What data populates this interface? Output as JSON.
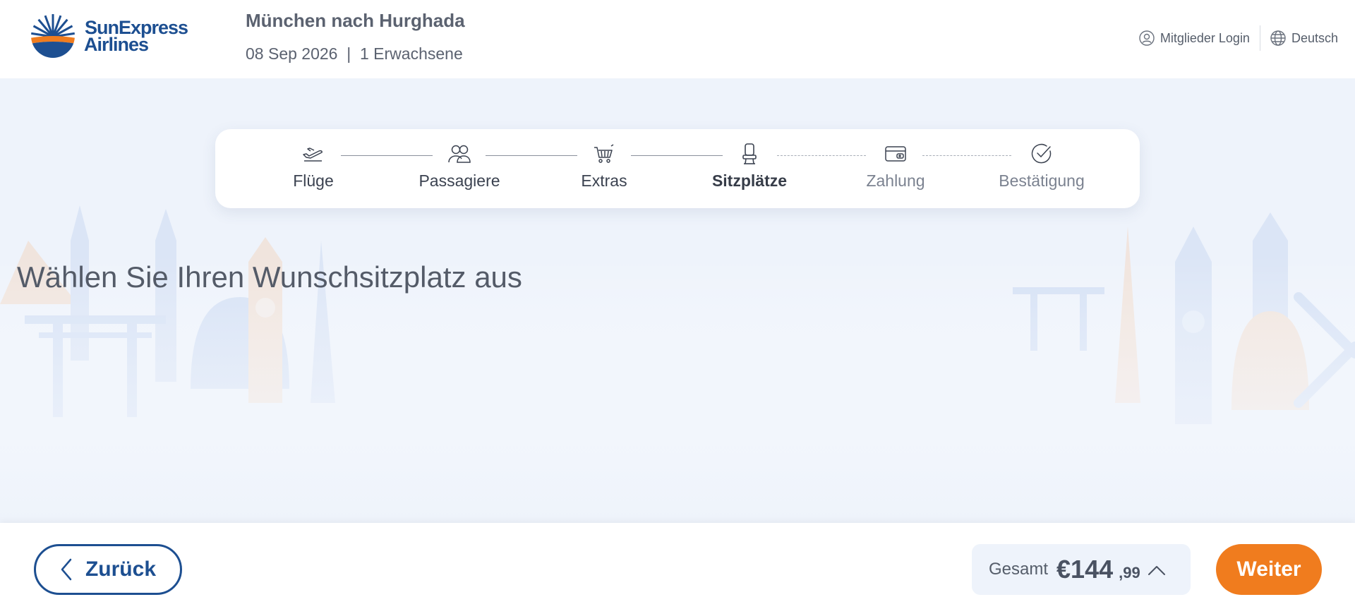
{
  "brand": {
    "line1": "SunExpress",
    "line2": "Airlines"
  },
  "trip": {
    "title": "München nach Hurghada",
    "subtitle": "08 Sep 2026  |  1 Erwachsene"
  },
  "header": {
    "login_label": "Mitglieder Login",
    "language_label": "Deutsch"
  },
  "steps": [
    {
      "label": "Flüge",
      "icon": "plane-departure-icon",
      "state": "done"
    },
    {
      "label": "Passagiere",
      "icon": "passengers-icon",
      "state": "done"
    },
    {
      "label": "Extras",
      "icon": "cart-icon",
      "state": "done"
    },
    {
      "label": "Sitzplätze",
      "icon": "seat-icon",
      "state": "active"
    },
    {
      "label": "Zahlung",
      "icon": "wallet-icon",
      "state": "future"
    },
    {
      "label": "Bestätigung",
      "icon": "checkmark-circle-icon",
      "state": "future"
    }
  ],
  "main": {
    "heading": "Wählen Sie Ihren Wunschsitzplatz aus"
  },
  "footer": {
    "back_label": "Zurück",
    "total_label": "Gesamt",
    "total_amount": "€144",
    "total_cents": ",99",
    "next_label": "Weiter"
  },
  "colors": {
    "brand_blue": "#1d4f91",
    "accent_orange": "#f07c1e",
    "background": "#eef3fb"
  }
}
